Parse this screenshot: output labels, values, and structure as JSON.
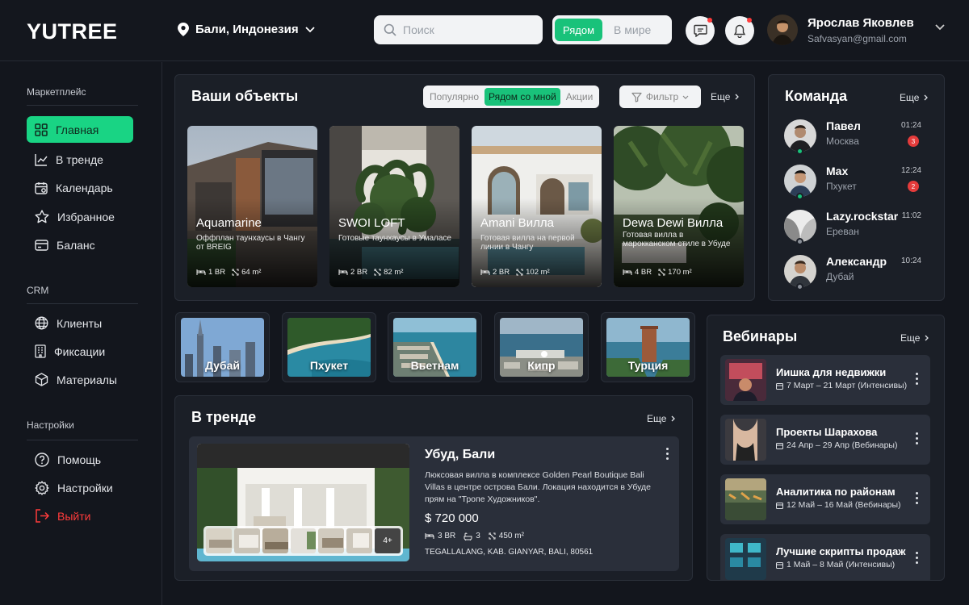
{
  "brand": {
    "logo": "YUTREE"
  },
  "header": {
    "location": "Бали, Индонезия",
    "search_placeholder": "Поиск",
    "scope_tabs": [
      {
        "label": "Рядом",
        "active": true
      },
      {
        "label": "В мире",
        "active": false
      }
    ],
    "user": {
      "name": "Ярослав Яковлев",
      "email": "Safvasyan@gmail.com"
    }
  },
  "sidebar": {
    "marketplace": {
      "title": "Маркетплейс",
      "items": [
        {
          "label": "Главная",
          "icon": "grid-icon",
          "active": true
        },
        {
          "label": "В тренде",
          "icon": "trend-icon"
        },
        {
          "label": "Календарь",
          "icon": "calendar-icon"
        },
        {
          "label": "Избранное",
          "icon": "star-icon"
        },
        {
          "label": "Баланс",
          "icon": "card-icon"
        }
      ]
    },
    "crm": {
      "title": "CRM",
      "items": [
        {
          "label": "Клиенты",
          "icon": "globe-icon"
        },
        {
          "label": "Фиксации",
          "icon": "building-icon"
        },
        {
          "label": "Материалы",
          "icon": "cube-icon"
        }
      ]
    },
    "settings": {
      "title": "Настройки",
      "items": [
        {
          "label": "Помощь",
          "icon": "help-icon"
        },
        {
          "label": "Настройки",
          "icon": "gear-icon"
        },
        {
          "label": "Выйти",
          "icon": "logout-icon"
        }
      ]
    }
  },
  "objects": {
    "title": "Ваши объекты",
    "filters": [
      {
        "label": "Популярно"
      },
      {
        "label": "Рядом со мной",
        "active": true
      },
      {
        "label": "Акции"
      }
    ],
    "filter_button": "Фильтр",
    "more": "Еще",
    "cards": [
      {
        "name": "Aquamarine",
        "desc": "Оффплан таунхаусы в Чангу от BREIG",
        "br": "1 BR",
        "area": "64 m²"
      },
      {
        "name": "SWOI LOFT",
        "desc": "Готовые таунхаусы в Умаласе",
        "br": "2 BR",
        "area": "82 m²"
      },
      {
        "name": "Amani Вилла",
        "desc": "Готовая вилла на первой линии в Чангу",
        "br": "2 BR",
        "area": "102 m²"
      },
      {
        "name": "Dewa Dewi Вилла",
        "desc": "Готовая вилла в марокканском  стиле в Убуде",
        "br": "4 BR",
        "area": "170 m²"
      }
    ]
  },
  "destinations": [
    "Дубай",
    "Пхукет",
    "Вьетнам",
    "Кипр",
    "Турция"
  ],
  "trending": {
    "title": "В тренде",
    "more": "Еще",
    "item": {
      "title": "Убуд, Бали",
      "desc": "Люксовая вилла  в  комплексе Golden Pearl Boutique Bali Villas в центре острова Бали.  Локация находится в Убуде прям на \"Тропе Художников\".",
      "price": "$ 720 000",
      "br": "3 BR",
      "baths": "3",
      "area": "450 m²",
      "address": "TEGALLALANG, KAB. GIANYAR, BALI, 80561",
      "more_photos": "4+"
    }
  },
  "team": {
    "title": "Команда",
    "more": "Еще",
    "members": [
      {
        "name": "Павел",
        "city": "Москва",
        "time": "01:24",
        "badge": "3",
        "online": true
      },
      {
        "name": "Max",
        "city": "Пхукет",
        "time": "12:24",
        "badge": "2",
        "online": true
      },
      {
        "name": "Lazy.rockstar",
        "city": "Ереван",
        "time": "11:02",
        "badge": "",
        "online": false
      },
      {
        "name": "Александр",
        "city": "Дубай",
        "time": "10:24",
        "badge": "",
        "online": false
      }
    ]
  },
  "webinars": {
    "title": "Вебинары",
    "more": "Еще",
    "items": [
      {
        "title": "Иишка для недвижки",
        "dates": "7 Март – 21 Март (Интенсивы)"
      },
      {
        "title": "Проекты Шарахова",
        "dates": "24 Апр – 29 Апр (Вебинары)"
      },
      {
        "title": "Аналитика по районам",
        "dates": "12 Май – 16 Май (Вебинары)"
      },
      {
        "title": "Лучшие скрипты продаж",
        "dates": "1 Май – 8 Май (Интенсивы)"
      }
    ]
  },
  "colors": {
    "accent": "#19d484",
    "danger": "#ff3b3b",
    "bg": "#13161d",
    "panel": "#1b1f27"
  }
}
